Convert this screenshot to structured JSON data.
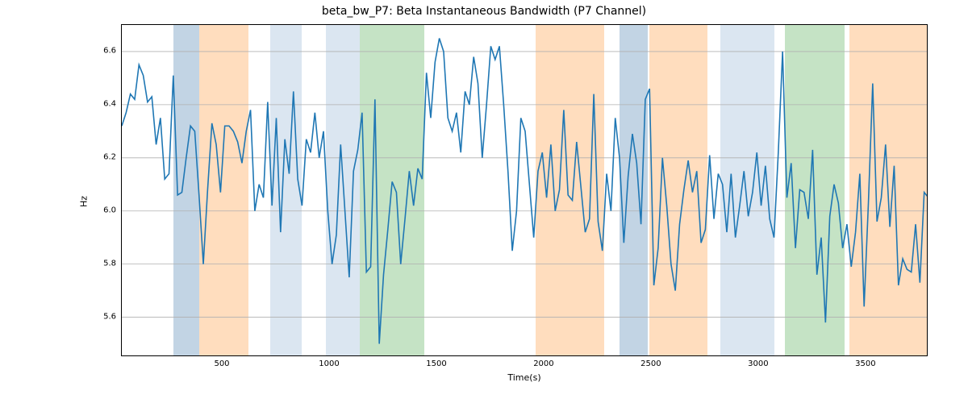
{
  "chart_data": {
    "type": "line",
    "title": "beta_bw_P7: Beta Instantaneous Bandwidth (P7 Channel)",
    "xlabel": "Time(s)",
    "ylabel": "Hz",
    "xlim": [
      30,
      3790
    ],
    "ylim": [
      5.45,
      6.7
    ],
    "xticks": [
      500,
      1000,
      1500,
      2000,
      2500,
      3000,
      3500
    ],
    "yticks": [
      5.6,
      5.8,
      6.0,
      6.2,
      6.4,
      6.6
    ],
    "x": [
      30,
      50,
      70,
      90,
      110,
      130,
      150,
      170,
      190,
      210,
      230,
      250,
      270,
      290,
      310,
      330,
      350,
      370,
      390,
      410,
      430,
      450,
      470,
      490,
      510,
      530,
      550,
      570,
      590,
      610,
      630,
      650,
      670,
      690,
      710,
      730,
      750,
      770,
      790,
      810,
      830,
      850,
      870,
      890,
      910,
      930,
      950,
      970,
      990,
      1010,
      1030,
      1050,
      1070,
      1090,
      1110,
      1130,
      1150,
      1170,
      1190,
      1210,
      1230,
      1250,
      1270,
      1290,
      1310,
      1330,
      1350,
      1370,
      1390,
      1410,
      1430,
      1450,
      1470,
      1490,
      1510,
      1530,
      1550,
      1570,
      1590,
      1610,
      1630,
      1650,
      1670,
      1690,
      1710,
      1730,
      1750,
      1770,
      1790,
      1810,
      1830,
      1850,
      1870,
      1890,
      1910,
      1930,
      1950,
      1970,
      1990,
      2010,
      2030,
      2050,
      2070,
      2090,
      2110,
      2130,
      2150,
      2170,
      2190,
      2210,
      2230,
      2250,
      2270,
      2290,
      2310,
      2330,
      2350,
      2370,
      2390,
      2410,
      2430,
      2450,
      2470,
      2490,
      2510,
      2530,
      2550,
      2570,
      2590,
      2610,
      2630,
      2650,
      2670,
      2690,
      2710,
      2730,
      2750,
      2770,
      2790,
      2810,
      2830,
      2850,
      2870,
      2890,
      2910,
      2930,
      2950,
      2970,
      2990,
      3010,
      3030,
      3050,
      3070,
      3090,
      3110,
      3130,
      3150,
      3170,
      3190,
      3210,
      3230,
      3250,
      3270,
      3290,
      3310,
      3330,
      3350,
      3370,
      3390,
      3410,
      3430,
      3450,
      3470,
      3490,
      3510,
      3530,
      3550,
      3570,
      3590,
      3610,
      3630,
      3650,
      3670,
      3690,
      3710,
      3730,
      3750,
      3770,
      3790
    ],
    "values": [
      6.32,
      6.37,
      6.44,
      6.42,
      6.55,
      6.51,
      6.41,
      6.43,
      6.25,
      6.35,
      6.12,
      6.14,
      6.51,
      6.06,
      6.07,
      6.2,
      6.32,
      6.3,
      6.06,
      5.8,
      6.08,
      6.33,
      6.25,
      6.07,
      6.32,
      6.32,
      6.3,
      6.26,
      6.18,
      6.3,
      6.38,
      6.0,
      6.1,
      6.05,
      6.41,
      6.02,
      6.35,
      5.92,
      6.27,
      6.14,
      6.45,
      6.12,
      6.02,
      6.27,
      6.22,
      6.37,
      6.2,
      6.3,
      6.0,
      5.8,
      5.91,
      6.25,
      6.0,
      5.75,
      6.15,
      6.23,
      6.37,
      5.77,
      5.79,
      6.42,
      5.5,
      5.76,
      5.93,
      6.11,
      6.07,
      5.8,
      5.97,
      6.15,
      6.02,
      6.16,
      6.12,
      6.52,
      6.35,
      6.56,
      6.65,
      6.6,
      6.35,
      6.3,
      6.37,
      6.22,
      6.45,
      6.4,
      6.58,
      6.48,
      6.2,
      6.4,
      6.62,
      6.57,
      6.62,
      6.4,
      6.15,
      5.85,
      6.0,
      6.35,
      6.3,
      6.1,
      5.9,
      6.15,
      6.22,
      6.05,
      6.25,
      6.0,
      6.08,
      6.38,
      6.06,
      6.04,
      6.26,
      6.09,
      5.92,
      5.97,
      6.44,
      5.96,
      5.85,
      6.14,
      6.0,
      6.35,
      6.2,
      5.88,
      6.13,
      6.29,
      6.18,
      5.95,
      6.42,
      6.46,
      5.72,
      5.86,
      6.2,
      6.02,
      5.8,
      5.7,
      5.95,
      6.08,
      6.19,
      6.07,
      6.15,
      5.88,
      5.93,
      6.21,
      5.97,
      6.14,
      6.1,
      5.92,
      6.14,
      5.9,
      6.02,
      6.15,
      5.98,
      6.07,
      6.22,
      6.02,
      6.17,
      5.97,
      5.9,
      6.22,
      6.6,
      6.05,
      6.18,
      5.86,
      6.08,
      6.07,
      5.97,
      6.23,
      5.76,
      5.9,
      5.58,
      5.98,
      6.1,
      6.03,
      5.86,
      5.95,
      5.79,
      5.92,
      6.14,
      5.64,
      6.03,
      6.48,
      5.96,
      6.05,
      6.25,
      5.94,
      6.17,
      5.72,
      5.82,
      5.78,
      5.77,
      5.95,
      5.73,
      6.07,
      6.05
    ],
    "regions": [
      {
        "x0": 270,
        "x1": 390,
        "color": "blue"
      },
      {
        "x0": 390,
        "x1": 620,
        "color": "orange"
      },
      {
        "x0": 720,
        "x1": 870,
        "color": "lblue"
      },
      {
        "x0": 980,
        "x1": 1140,
        "color": "lblue"
      },
      {
        "x0": 1140,
        "x1": 1440,
        "color": "green"
      },
      {
        "x0": 1960,
        "x1": 2280,
        "color": "orange"
      },
      {
        "x0": 2350,
        "x1": 2480,
        "color": "blue"
      },
      {
        "x0": 2490,
        "x1": 2760,
        "color": "orange"
      },
      {
        "x0": 2820,
        "x1": 3070,
        "color": "lblue"
      },
      {
        "x0": 3120,
        "x1": 3400,
        "color": "green"
      },
      {
        "x0": 3420,
        "x1": 3790,
        "color": "orange"
      }
    ]
  }
}
